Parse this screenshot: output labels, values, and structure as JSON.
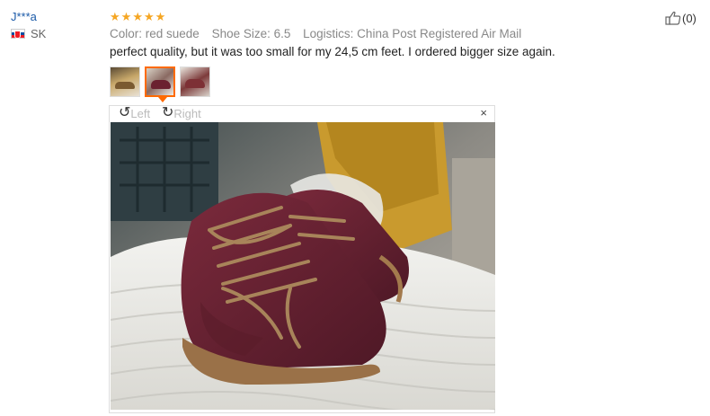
{
  "user": {
    "name": "J***a",
    "country": "SK"
  },
  "review": {
    "rating": 5,
    "attributes": [
      "Color: red suede",
      "Shoe Size: 6.5",
      "Logistics: China Post Registered Air Mail"
    ],
    "text": "perfect quality, but it was too small for my 24,5 cm feet. I ordered bigger size again."
  },
  "helpful": {
    "count": "(0)"
  },
  "viewer": {
    "rotate_left": "Left",
    "rotate_right": "Right",
    "close": "×"
  },
  "icons": {
    "thumb_up": "thumb-up-icon",
    "star": "star-icon",
    "rotate_left": "rotate-left-icon",
    "rotate_right": "rotate-right-icon",
    "close": "close-icon",
    "flag": "slovakia-flag-icon"
  },
  "colors": {
    "user_link": "#1b5aa8",
    "star": "#f5a623",
    "active_thumb": "#ff6a00",
    "shoe": "#6b2130"
  }
}
